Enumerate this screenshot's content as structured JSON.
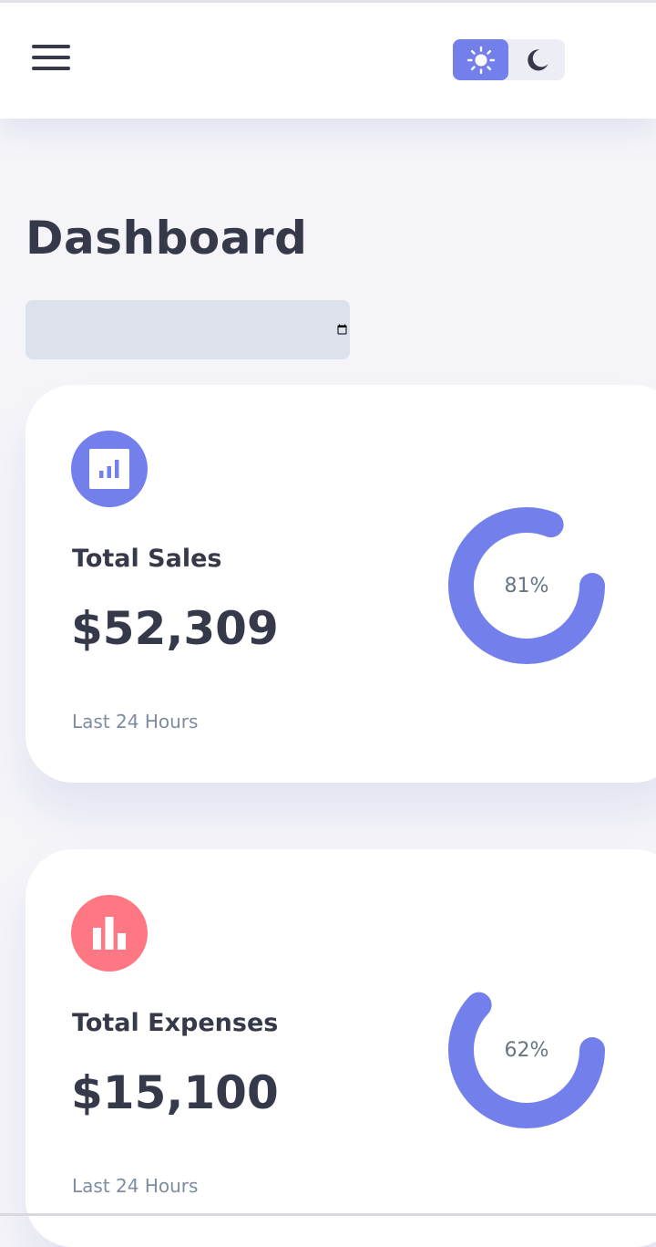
{
  "header": {
    "menu_icon": "hamburger-menu-icon",
    "theme_toggle": {
      "light_icon": "sun-icon",
      "dark_icon": "moon-icon",
      "active": "light"
    }
  },
  "main": {
    "title": "Dashboard",
    "date_field_value": "",
    "cards": [
      {
        "id": "sales",
        "icon": "analytics-icon",
        "icon_color": "#7380ec",
        "label": "Total Sales",
        "value": "$52,309",
        "percent_label": "81%",
        "percent": 81,
        "note": "Last 24 Hours"
      },
      {
        "id": "expenses",
        "icon": "bar-chart-icon",
        "icon_color": "#ff7782",
        "label": "Total Expenses",
        "value": "$15,100",
        "percent_label": "62%",
        "percent": 62,
        "note": "Last 24 Hours"
      }
    ]
  },
  "colors": {
    "primary": "#7380ec",
    "danger": "#ff7782",
    "background": "#f5f5f9",
    "text_dark": "#363949",
    "text_muted": "#7d8da1"
  }
}
